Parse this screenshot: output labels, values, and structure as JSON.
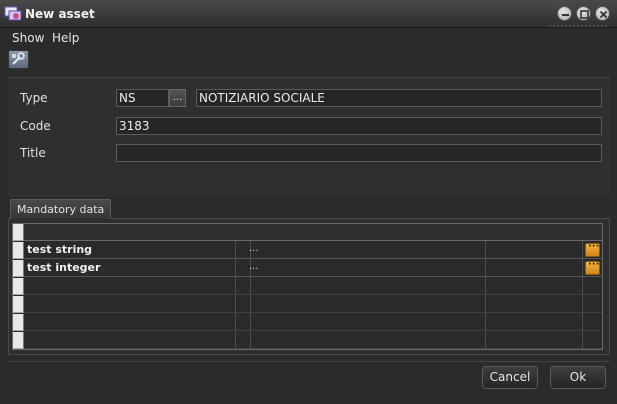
{
  "window": {
    "title": "New asset",
    "icon": "asset-icon"
  },
  "window_controls": [
    {
      "name": "minimize-icon"
    },
    {
      "name": "maximize-icon"
    },
    {
      "name": "close-icon"
    }
  ],
  "menu": {
    "items": [
      "Show",
      "Help"
    ]
  },
  "toolbar": {
    "icon": "tool-icon"
  },
  "form": {
    "type_label": "Type",
    "type_code": "NS",
    "type_browse": "...",
    "type_description": "NOTIZIARIO SOCIALE",
    "code_label": "Code",
    "code_value": "3183",
    "title_label": "Title",
    "title_value": ""
  },
  "tabs": [
    {
      "label": "Mandatory data"
    }
  ],
  "grid": {
    "rows": [
      {
        "name": "test string",
        "browse": "...",
        "edit": "···"
      },
      {
        "name": "test integer",
        "browse": "...",
        "edit": "···"
      }
    ]
  },
  "actions": {
    "cancel": "Cancel",
    "ok": "Ok"
  },
  "colors": {
    "background": "#2b2b2b",
    "edit_button": "#e99c2a"
  }
}
